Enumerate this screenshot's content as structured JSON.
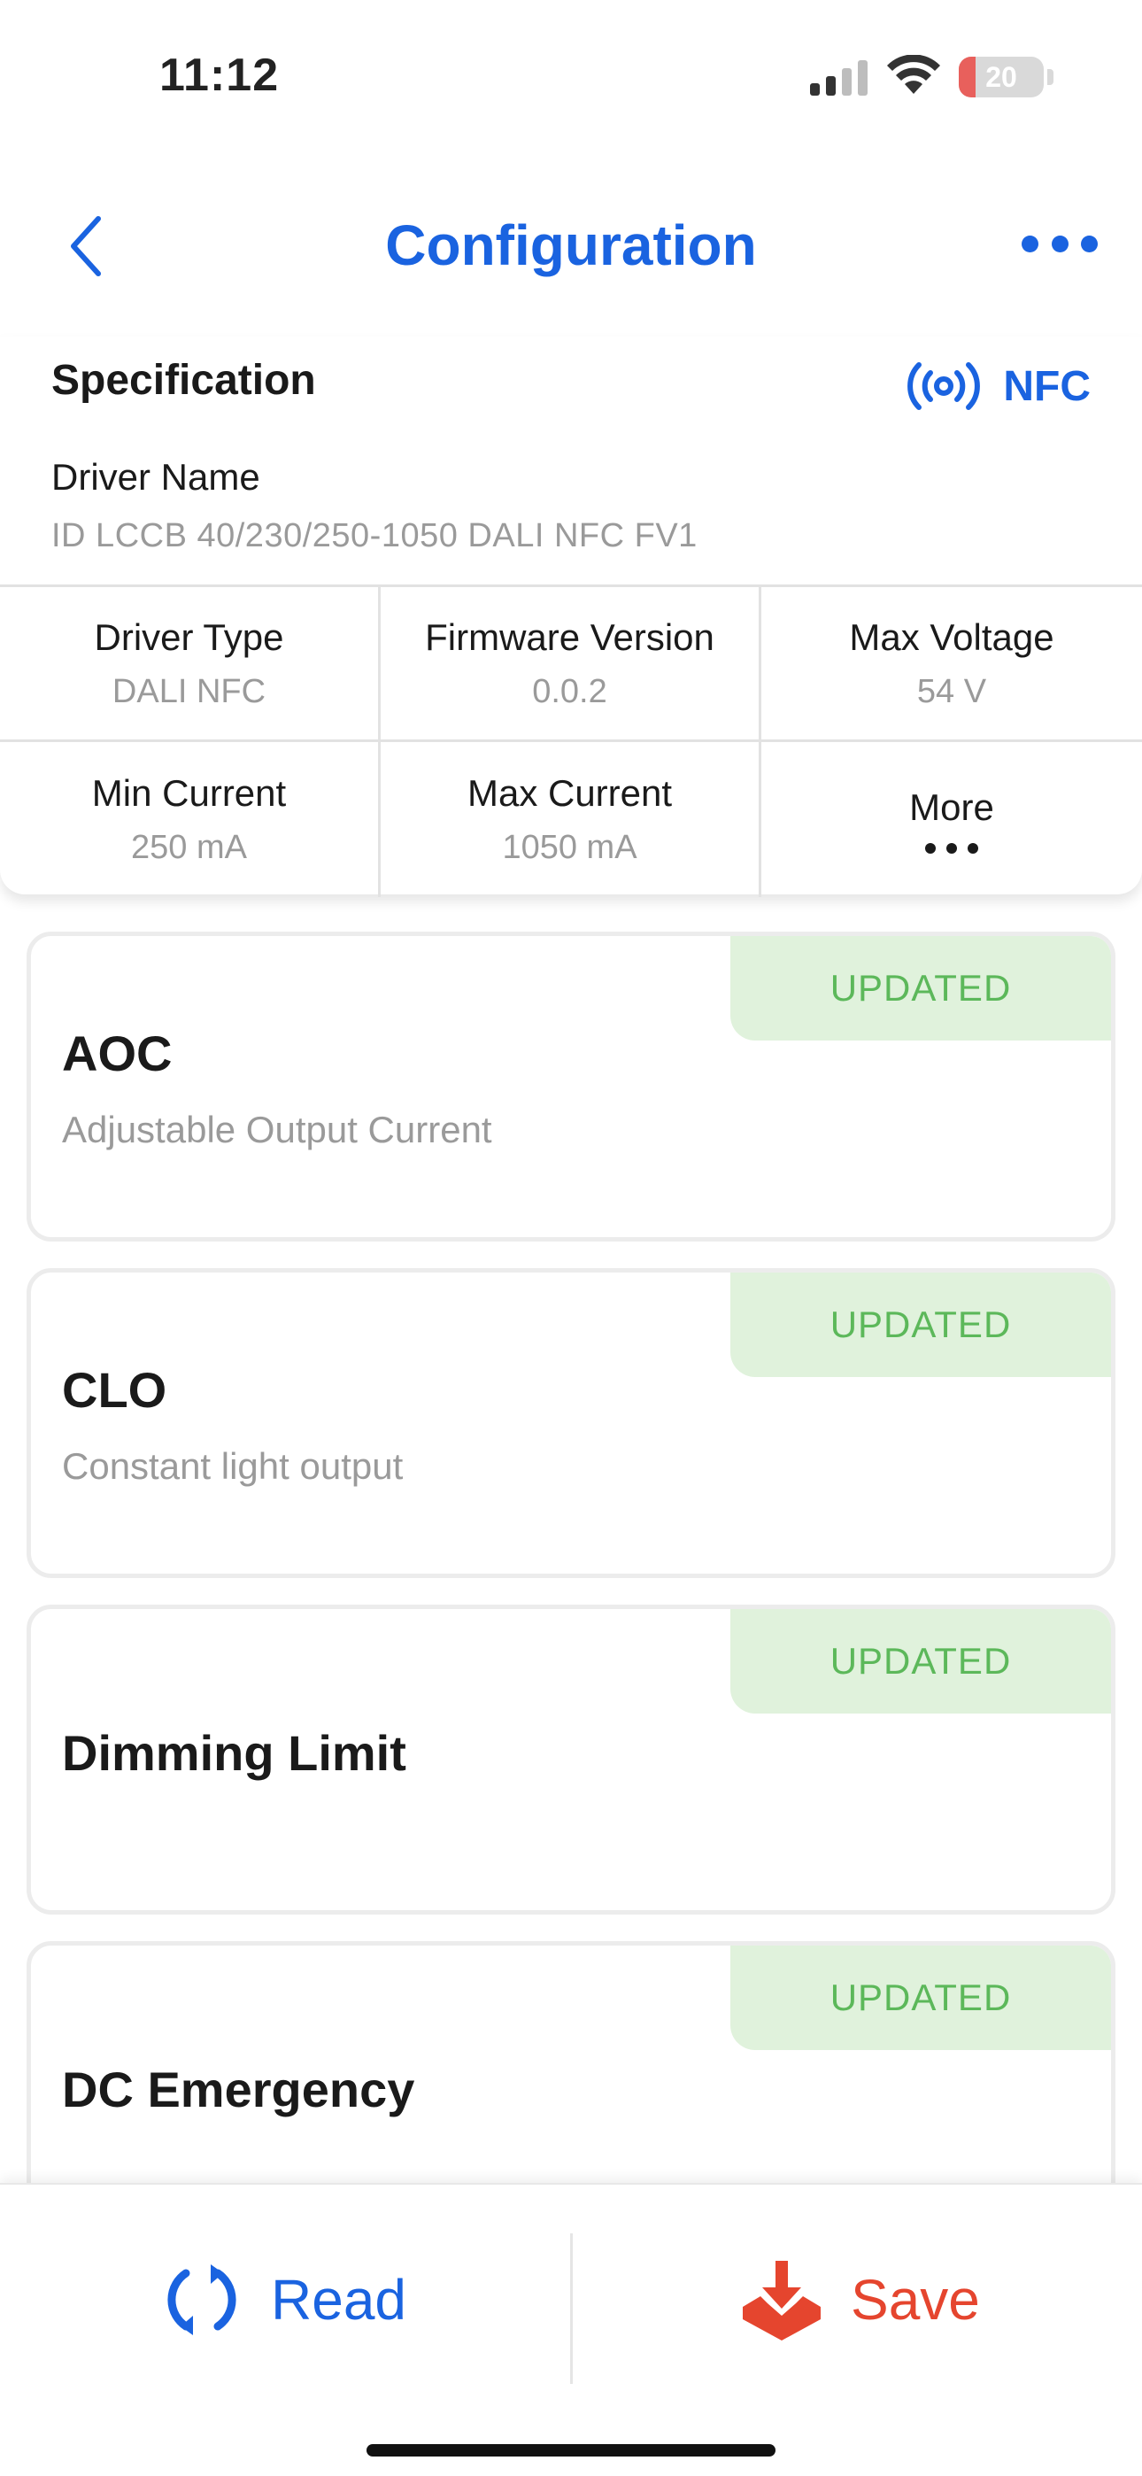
{
  "status_bar": {
    "time": "11:12",
    "battery_level": "20",
    "battery_fraction": 0.2,
    "battery_color": "#e8605c"
  },
  "nav": {
    "title": "Configuration",
    "back_icon": "chevron-left-icon",
    "more_icon": "ellipsis-icon"
  },
  "specification": {
    "title": "Specification",
    "nfc_label": "NFC",
    "nfc_icon": "nfc-signal-icon",
    "driver_name_label": "Driver Name",
    "driver_name_value": "ID LCCB 40/230/250-1050 DALI NFC FV1",
    "grid": [
      {
        "label": "Driver Type",
        "value": "DALI NFC"
      },
      {
        "label": "Firmware Version",
        "value": "0.0.2"
      },
      {
        "label": "Max Voltage",
        "value": "54 V"
      },
      {
        "label": "Min Current",
        "value": "250 mA"
      },
      {
        "label": "Max Current",
        "value": "1050 mA"
      },
      {
        "label": "More",
        "value": ""
      }
    ]
  },
  "features": [
    {
      "title": "AOC",
      "subtitle": "Adjustable Output Current",
      "badge": "UPDATED"
    },
    {
      "title": "CLO",
      "subtitle": "Constant light output",
      "badge": "UPDATED"
    },
    {
      "title": "Dimming Limit",
      "subtitle": "",
      "badge": "UPDATED"
    },
    {
      "title": "DC Emergency",
      "subtitle": "",
      "badge": "UPDATED"
    }
  ],
  "bottom_bar": {
    "read_label": "Read",
    "read_icon": "refresh-icon",
    "save_label": "Save",
    "save_icon": "download-tray-icon"
  },
  "colors": {
    "accent": "#1a63e0",
    "save": "#e5452e",
    "badge_bg": "#e0f2dc",
    "badge_text": "#5cb85a"
  }
}
